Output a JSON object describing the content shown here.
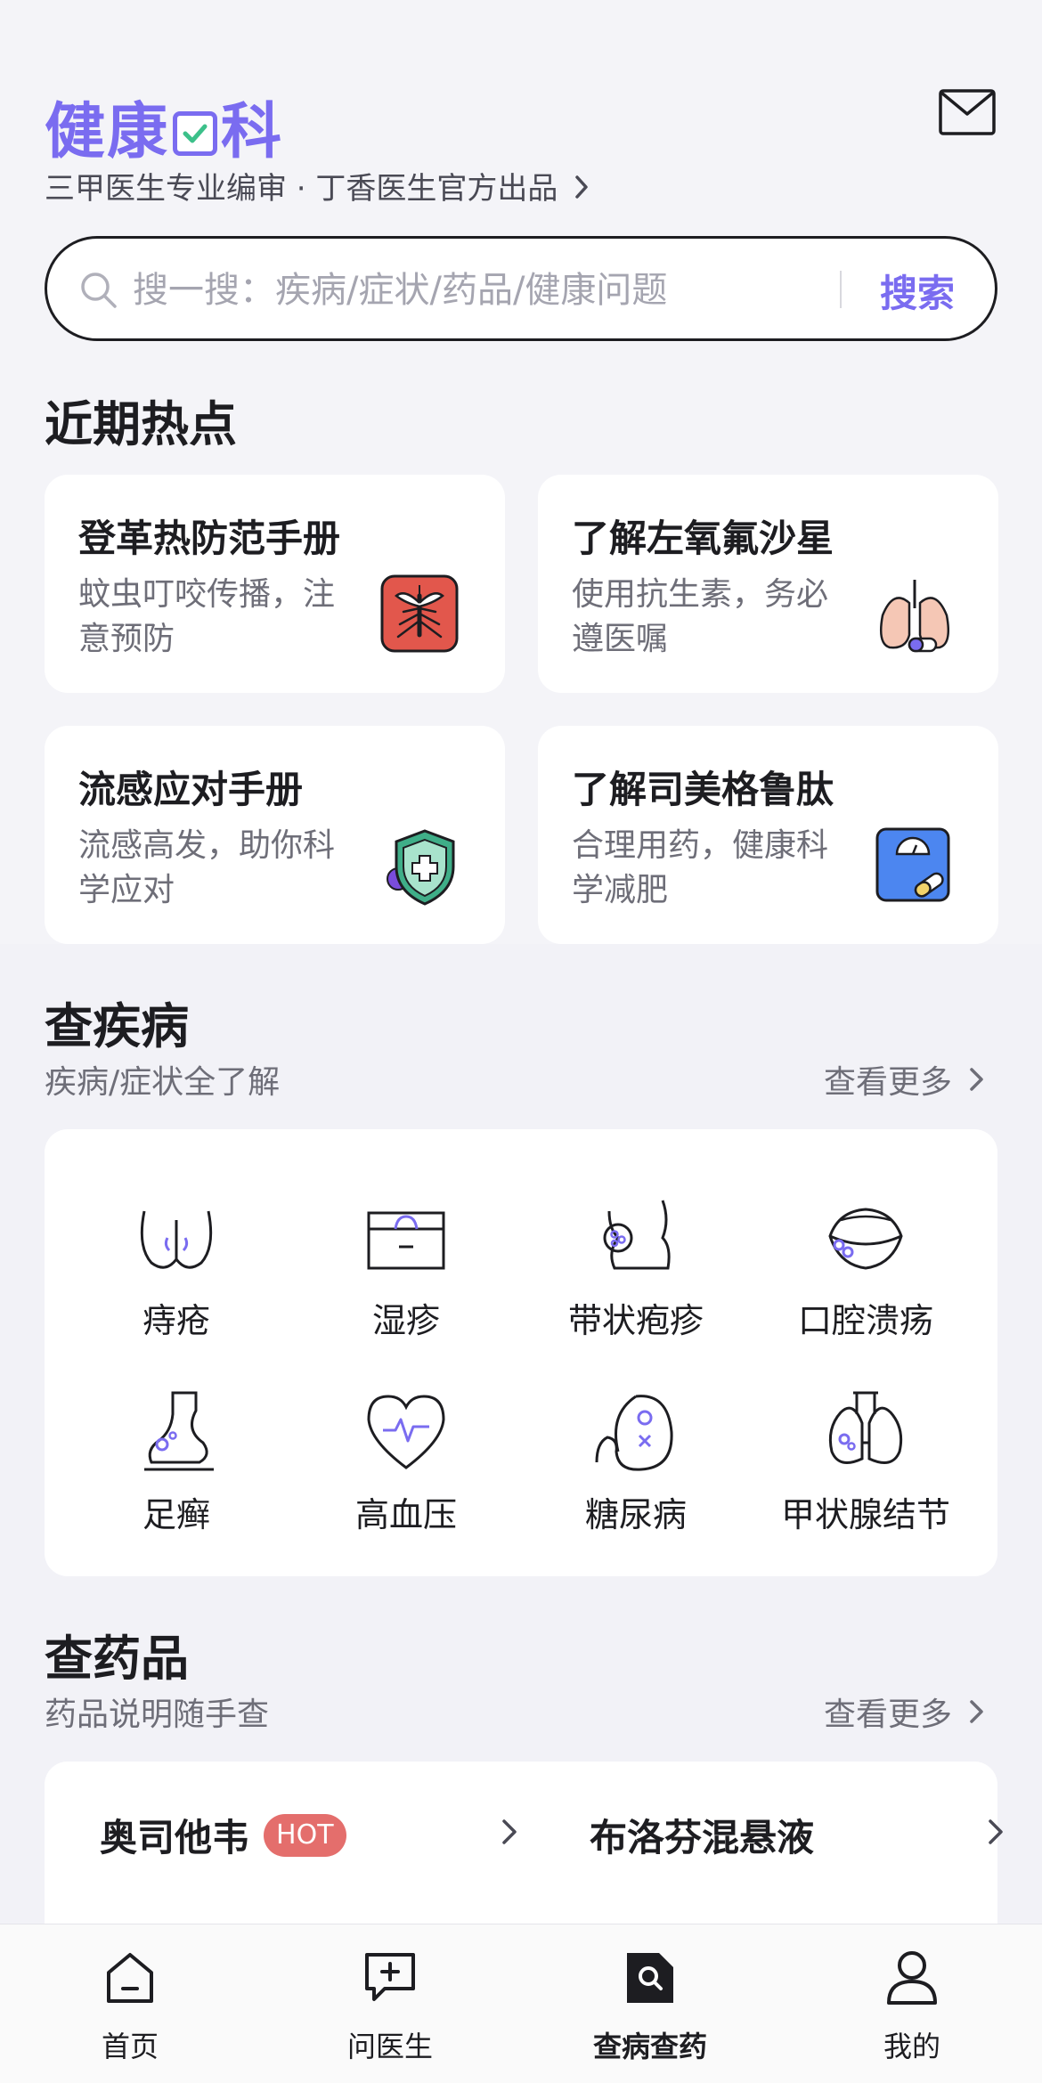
{
  "header": {
    "title_pre": "健康",
    "title_post": "科",
    "subtitle": "三甲医生专业编审 · 丁香医生官方出品"
  },
  "search": {
    "placeholder": "搜一搜：疾病/症状/药品/健康问题",
    "button": "搜索"
  },
  "hot": {
    "title": "近期热点",
    "cards": [
      {
        "title": "登革热防范手册",
        "desc": "蚊虫叮咬传播，注意预防",
        "icon": "mosquito-icon"
      },
      {
        "title": "了解左氧氟沙星",
        "desc": "使用抗生素，务必遵医嘱",
        "icon": "lungs-icon"
      },
      {
        "title": "流感应对手册",
        "desc": "流感高发，助你科学应对",
        "icon": "shield-icon"
      },
      {
        "title": "了解司美格鲁肽",
        "desc": "合理用药，健康科学减肥",
        "icon": "scale-icon"
      }
    ]
  },
  "diseases": {
    "title": "查疾病",
    "subtitle": "疾病/症状全了解",
    "more": "查看更多",
    "items": [
      {
        "label": "痔疮",
        "icon": "buttocks-icon"
      },
      {
        "label": "湿疹",
        "icon": "skin-icon"
      },
      {
        "label": "带状疱疹",
        "icon": "torso-icon"
      },
      {
        "label": "口腔溃疡",
        "icon": "mouth-icon"
      },
      {
        "label": "足癣",
        "icon": "foot-icon"
      },
      {
        "label": "高血压",
        "icon": "heart-icon"
      },
      {
        "label": "糖尿病",
        "icon": "kidney-icon"
      },
      {
        "label": "甲状腺结节",
        "icon": "thyroid-icon"
      }
    ]
  },
  "drugs": {
    "title": "查药品",
    "subtitle": "药品说明随手查",
    "more": "查看更多",
    "items": [
      {
        "name": "奥司他韦",
        "badge": "HOT"
      },
      {
        "name": "布洛芬混悬液",
        "badge": ""
      }
    ]
  },
  "tabbar": {
    "tabs": [
      {
        "label": "首页",
        "icon": "home-icon"
      },
      {
        "label": "问医生",
        "icon": "chat-plus-icon"
      },
      {
        "label": "查病查药",
        "icon": "search-doc-icon",
        "active": true
      },
      {
        "label": "我的",
        "icon": "person-icon"
      }
    ]
  },
  "colors": {
    "accent": "#7a6cf0",
    "hot_badge": "#e46e6c",
    "background": "#f2f2f7"
  }
}
